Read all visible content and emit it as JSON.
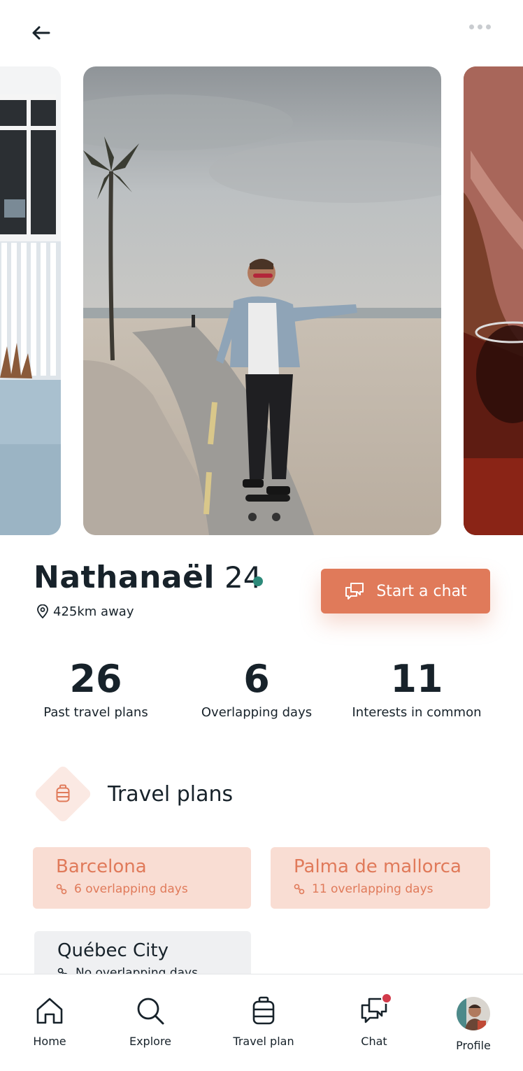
{
  "icons": {
    "back": "arrow-left-icon",
    "more": "more-horizontal-icon",
    "location": "location-pin-icon",
    "chat": "chat-bubbles-icon",
    "luggage": "luggage-icon",
    "overlap": "overlap-percent-icon"
  },
  "colors": {
    "accent": "#e07a5a",
    "accent_light": "#f9ddd3",
    "online": "#2d8a7a",
    "text": "#17222a",
    "badge": "#d23a4a"
  },
  "profile": {
    "name": "Nathanaël",
    "age": "24",
    "online": true,
    "distance": "425km away",
    "start_chat_label": "Start a chat"
  },
  "stats": [
    {
      "value": "26",
      "label": "Past travel plans"
    },
    {
      "value": "6",
      "label": "Overlapping days"
    },
    {
      "value": "11",
      "label": "Interests in common"
    }
  ],
  "travel_plans": {
    "title": "Travel plans",
    "items": [
      {
        "city": "Barcelona",
        "days": "6 overlapping days"
      },
      {
        "city": "Palma de mallorca",
        "days": "11 overlapping days"
      },
      {
        "city": "Québec City",
        "days": "No overlapping days"
      }
    ]
  },
  "nav": {
    "items": [
      {
        "label": "Home",
        "icon": "home-icon"
      },
      {
        "label": "Explore",
        "icon": "search-icon"
      },
      {
        "label": "Travel plan",
        "icon": "luggage-icon"
      },
      {
        "label": "Chat",
        "icon": "chat-icon",
        "has_notification": true
      },
      {
        "label": "Profile",
        "icon": "avatar"
      }
    ]
  }
}
